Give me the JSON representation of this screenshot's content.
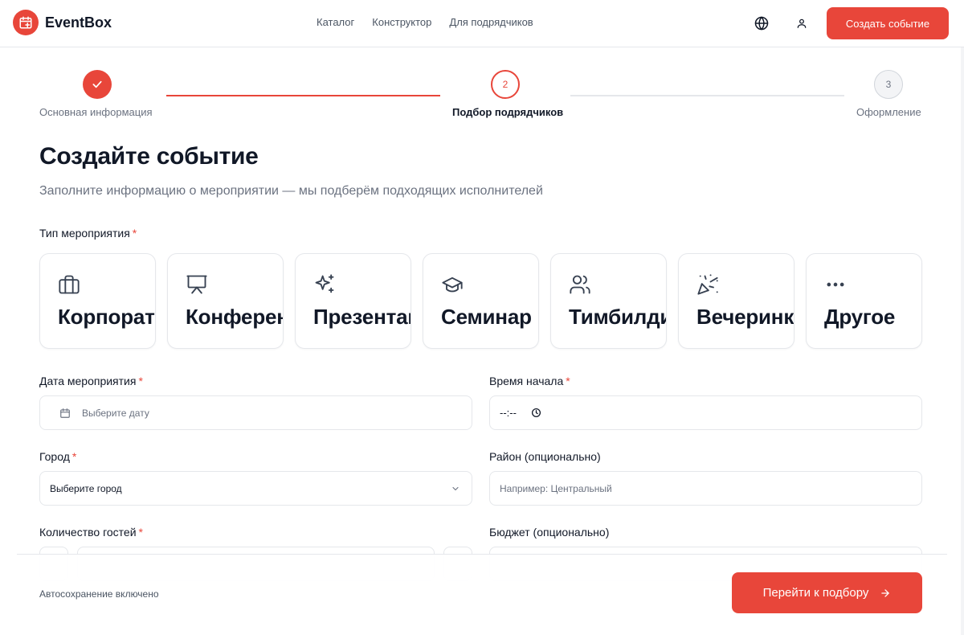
{
  "app": {
    "name": "EventBox",
    "brand_color": "#e8463a"
  },
  "nav": [
    {
      "label": "Каталог"
    },
    {
      "label": "Конструктор"
    },
    {
      "label": "Для подрядчиков"
    }
  ],
  "header": {
    "create_button": "Создать событие",
    "icons": [
      "globe-icon",
      "user-icon"
    ]
  },
  "stepper": {
    "current": 2,
    "steps": [
      {
        "number": "1",
        "label": "Основная информация",
        "state": "done"
      },
      {
        "number": "2",
        "label": "Подбор подрядчиков",
        "state": "current"
      },
      {
        "number": "3",
        "label": "Оформление",
        "state": "pending"
      }
    ]
  },
  "page": {
    "title": "Создайте событие",
    "subtitle": "Заполните информацию о мероприятии — мы подберём подходящих исполнителей"
  },
  "event_type": {
    "label": "Тип мероприятия",
    "required_mark": "*",
    "options": [
      {
        "label": "Корпоратив",
        "icon": "briefcase-icon"
      },
      {
        "label": "Конференция",
        "icon": "presentation-icon"
      },
      {
        "label": "Презентация",
        "icon": "sparkles-icon"
      },
      {
        "label": "Семинар",
        "icon": "graduation-cap-icon"
      },
      {
        "label": "Тимбилдинг",
        "icon": "users-icon"
      },
      {
        "label": "Вечеринка",
        "icon": "party-popper-icon"
      },
      {
        "label": "Другое",
        "icon": "more-dots-icon"
      }
    ]
  },
  "form": {
    "date": {
      "label": "Дата мероприятия",
      "required_mark": "*",
      "placeholder": "Выберите дату"
    },
    "time": {
      "label": "Время начала",
      "required_mark": "*",
      "value": "--:--"
    },
    "city": {
      "label": "Город",
      "required_mark": "*",
      "value": "Выберите город"
    },
    "district": {
      "label": "Район (опционально)",
      "placeholder": "Например: Центральный"
    },
    "guests": {
      "label": "Количество гостей",
      "required_mark": "*"
    },
    "budget": {
      "label": "Бюджет (опционально)"
    }
  },
  "footer": {
    "autosave": "Автосохранение включено",
    "next_button": "Перейти к подбору"
  }
}
